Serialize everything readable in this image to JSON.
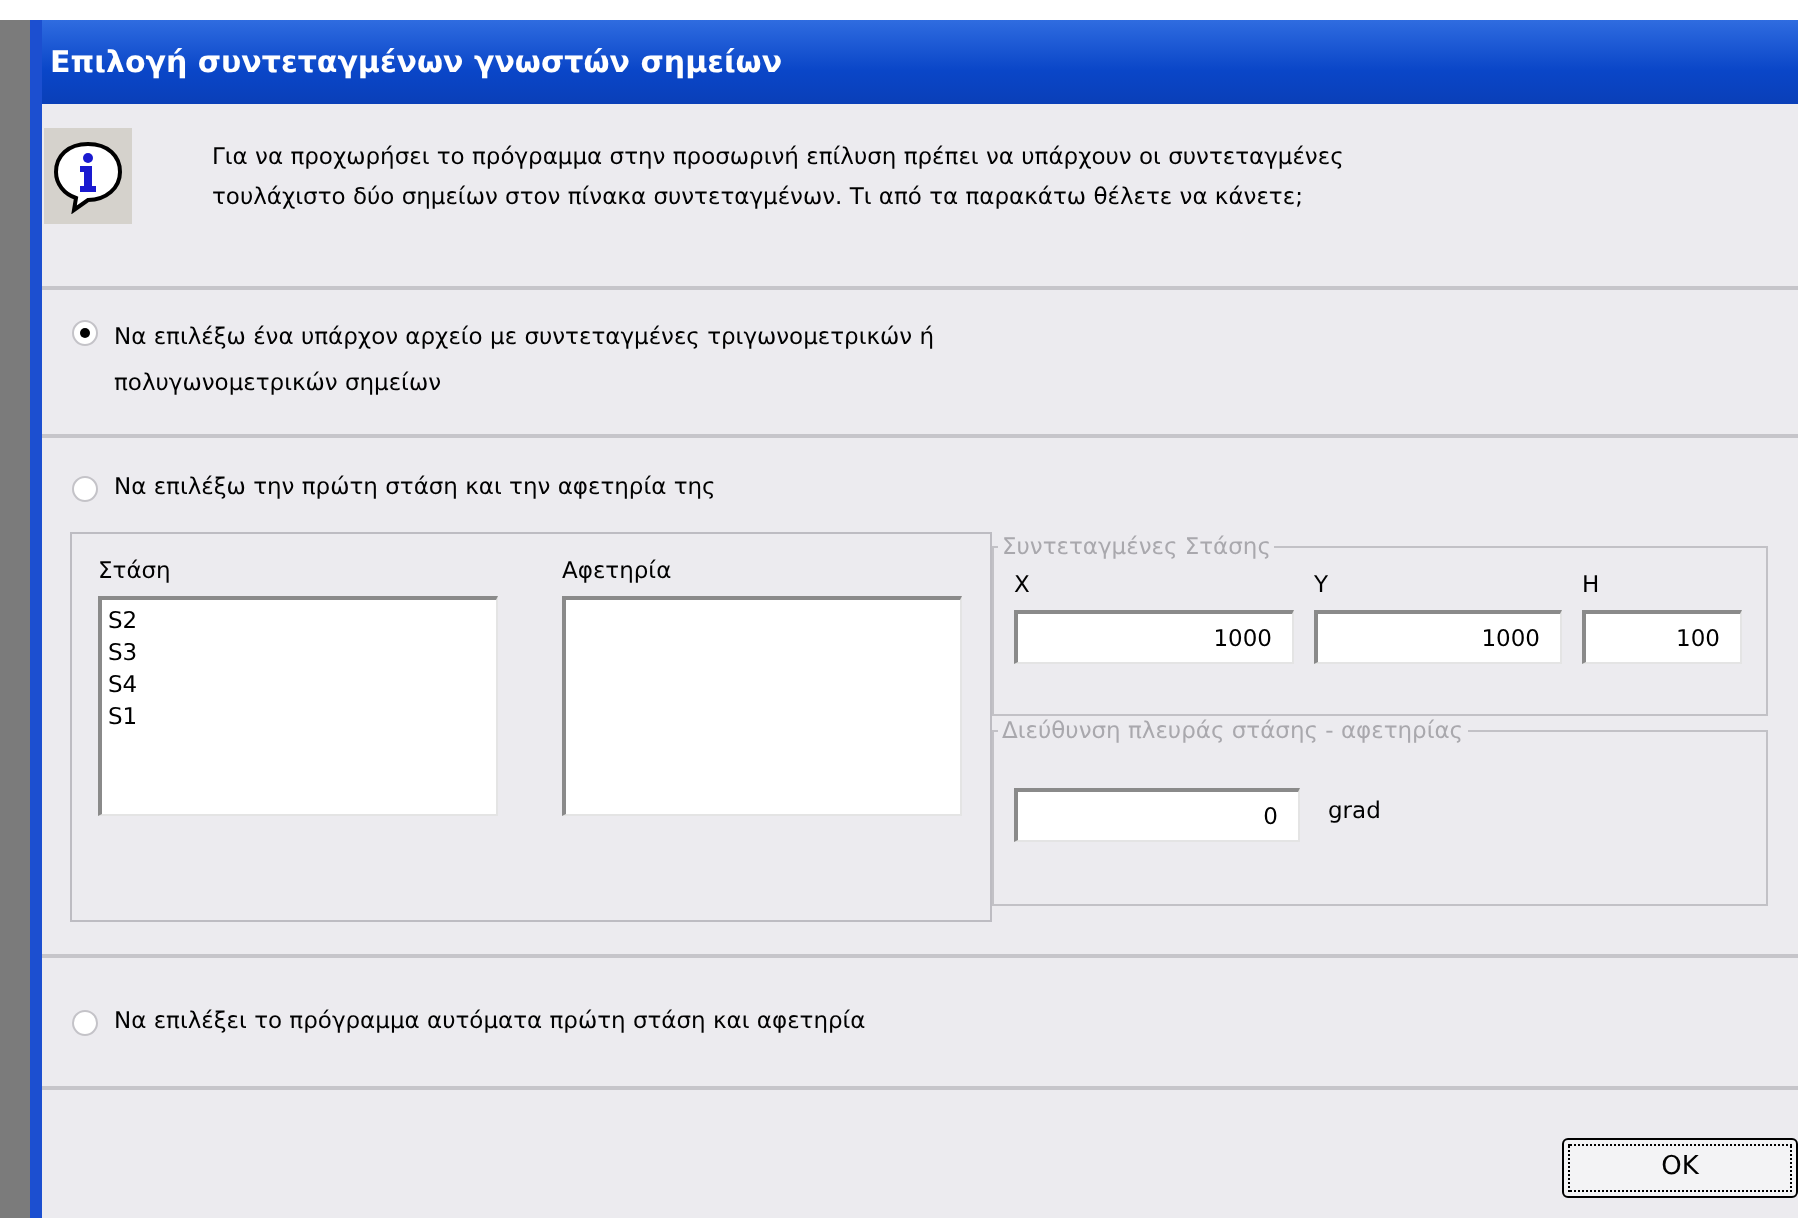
{
  "window": {
    "title": "Επιλογή συντεταγμένων γνωστών σημείων"
  },
  "info": {
    "text": "Για να προχωρήσει το πρόγραμμα στην προσωρινή επίλυση πρέπει να υπάρχουν οι συντεταγμένες τουλάχιστο δύο σημείων στον πίνακα συντεταγμένων. Τι από τα παρακάτω θέλετε να κάνετε;"
  },
  "options": [
    {
      "label": "Να επιλέξω ένα υπάρχον αρχείο με συντεταγμένες τριγωνομετρικών ή πολυγωνομετρικών σημείων",
      "selected": true
    },
    {
      "label": "Να επιλέξω την πρώτη στάση και την αφετηρία της",
      "selected": false
    },
    {
      "label": "Να επιλέξει το πρόγραμμα αυτόματα πρώτη στάση και αφετηρία",
      "selected": false
    }
  ],
  "station_list": {
    "label": "Στάση",
    "items": [
      "S2",
      "S3",
      "S4",
      "S1"
    ]
  },
  "origin_list": {
    "label": "Αφετηρία"
  },
  "station_coordinates": {
    "legend": "Συντεταγμένες Στάσης",
    "fields": [
      {
        "label": "X",
        "value": "1000"
      },
      {
        "label": "Y",
        "value": "1000"
      },
      {
        "label": "H",
        "value": "100"
      }
    ]
  },
  "direction": {
    "legend": "Διεύθυνση πλευράς στάσης - αφετηρίας",
    "value": "0",
    "unit": "grad"
  },
  "buttons": [
    "OK"
  ]
}
